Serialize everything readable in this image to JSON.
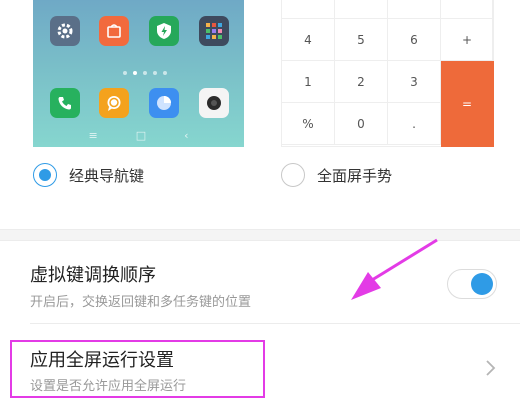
{
  "previews": {
    "classic": {
      "calendar_icon": "calendar-icon",
      "apps": [
        "settings-icon",
        "mi-store-icon",
        "security-icon",
        "apps-folder-icon",
        "phone-icon",
        "messages-icon",
        "browser-icon",
        "camera-icon"
      ]
    },
    "calculator": {
      "keys": [
        "4",
        "5",
        "6",
        "+",
        "1",
        "2",
        "3",
        "=",
        "%",
        "0",
        "."
      ]
    }
  },
  "options": {
    "classic_label": "经典导航键",
    "gesture_label": "全面屏手势",
    "selected": "classic"
  },
  "settings": {
    "swap_keys": {
      "title": "虚拟键调换顺序",
      "subtitle": "开启后，交换返回键和多任务键的位置",
      "enabled": true
    },
    "fullscreen_apps": {
      "title": "应用全屏运行设置",
      "subtitle": "设置是否允许应用全屏运行"
    }
  },
  "colors": {
    "accent": "#2f9be6",
    "equals_key": "#ee6a3a",
    "annotation": "#e33be6"
  }
}
